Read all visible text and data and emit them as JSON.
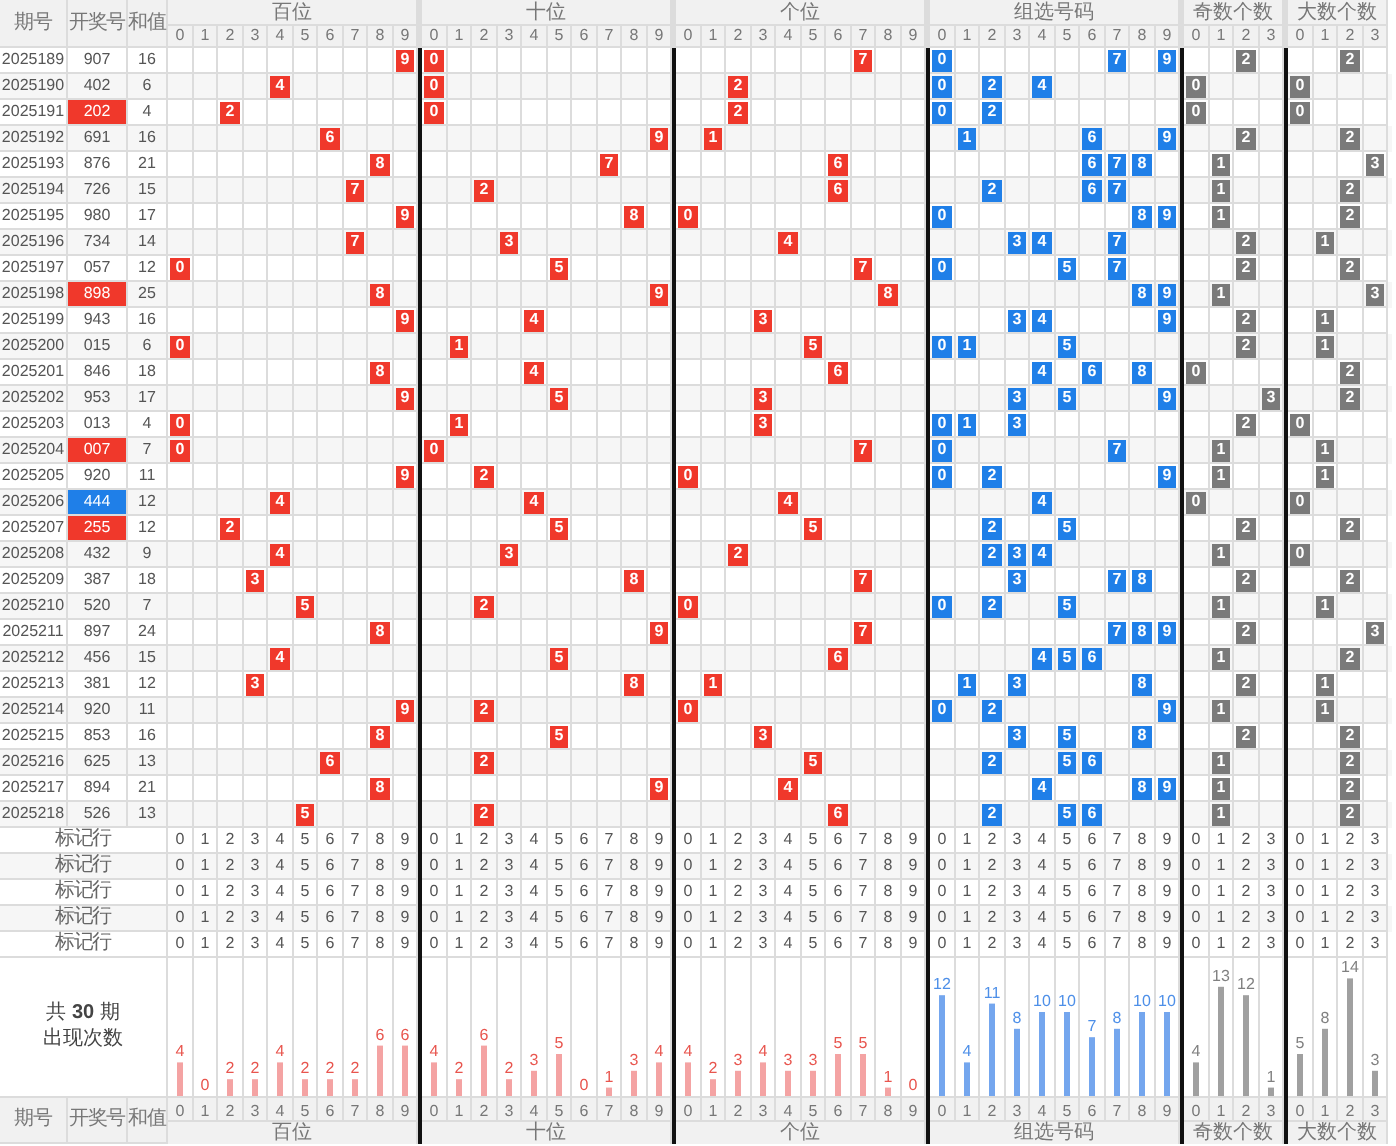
{
  "header": {
    "columns": [
      "期号",
      "开奖号",
      "和值"
    ]
  },
  "groups": [
    {
      "kind": "hundreds",
      "title": "百位",
      "digits": [
        "0",
        "1",
        "2",
        "3",
        "4",
        "5",
        "6",
        "7",
        "8",
        "9"
      ],
      "chart_data": {
        "type": "bar",
        "categories": [
          "0",
          "1",
          "2",
          "3",
          "4",
          "5",
          "6",
          "7",
          "8",
          "9"
        ],
        "series": [
          {
            "name": "百位",
            "color": "#f4a3a3",
            "values": [
              4,
              0,
              2,
              2,
              4,
              2,
              2,
              2,
              6,
              6
            ]
          }
        ],
        "data_labels": true
      }
    },
    {
      "kind": "tens",
      "title": "十位",
      "digits": [
        "0",
        "1",
        "2",
        "3",
        "4",
        "5",
        "6",
        "7",
        "8",
        "9"
      ],
      "chart_data": {
        "type": "bar",
        "categories": [
          "0",
          "1",
          "2",
          "3",
          "4",
          "5",
          "6",
          "7",
          "8",
          "9"
        ],
        "series": [
          {
            "name": "十位",
            "color": "#f4a3a3",
            "values": [
              4,
              2,
              6,
              2,
              3,
              5,
              0,
              1,
              3,
              4
            ]
          }
        ],
        "data_labels": true
      }
    },
    {
      "kind": "units",
      "title": "个位",
      "digits": [
        "0",
        "1",
        "2",
        "3",
        "4",
        "5",
        "6",
        "7",
        "8",
        "9"
      ],
      "chart_data": {
        "type": "bar",
        "categories": [
          "0",
          "1",
          "2",
          "3",
          "4",
          "5",
          "6",
          "7",
          "8",
          "9"
        ],
        "series": [
          {
            "name": "个位",
            "color": "#f4a3a3",
            "values": [
              4,
              2,
              3,
              4,
              3,
              3,
              5,
              5,
              1,
              0
            ]
          }
        ],
        "data_labels": true
      }
    },
    {
      "kind": "combo",
      "title": "组选号码",
      "digits": [
        "0",
        "1",
        "2",
        "3",
        "4",
        "5",
        "6",
        "7",
        "8",
        "9"
      ],
      "chart_data": {
        "type": "bar",
        "categories": [
          "0",
          "1",
          "2",
          "3",
          "4",
          "5",
          "6",
          "7",
          "8",
          "9"
        ],
        "series": [
          {
            "name": "组选号码",
            "color": "#74a6ee",
            "values": [
              12,
              4,
              11,
              8,
              10,
              10,
              7,
              8,
              10,
              10
            ]
          }
        ],
        "data_labels": true
      }
    },
    {
      "kind": "odd_count",
      "title": "奇数个数",
      "digits": [
        "0",
        "1",
        "2",
        "3"
      ],
      "chart_data": {
        "type": "bar",
        "categories": [
          "0",
          "1",
          "2",
          "3"
        ],
        "series": [
          {
            "name": "奇数个数",
            "color": "#a0a0a0",
            "values": [
              4,
              13,
              12,
              1
            ]
          }
        ],
        "data_labels": true
      }
    },
    {
      "kind": "big_count",
      "title": "大数个数",
      "digits": [
        "0",
        "1",
        "2",
        "3"
      ],
      "chart_data": {
        "type": "bar",
        "categories": [
          "0",
          "1",
          "2",
          "3"
        ],
        "series": [
          {
            "name": "大数个数",
            "color": "#a0a0a0",
            "values": [
              5,
              8,
              14,
              3
            ]
          }
        ],
        "data_labels": true
      }
    }
  ],
  "rows": [
    {
      "issue": "2025189",
      "number": "907",
      "sum": "16",
      "kind": "group6"
    },
    {
      "issue": "2025190",
      "number": "402",
      "sum": "6",
      "kind": "group6"
    },
    {
      "issue": "2025191",
      "number": "202",
      "sum": "4",
      "kind": "group3"
    },
    {
      "issue": "2025192",
      "number": "691",
      "sum": "16",
      "kind": "group6"
    },
    {
      "issue": "2025193",
      "number": "876",
      "sum": "21",
      "kind": "group6"
    },
    {
      "issue": "2025194",
      "number": "726",
      "sum": "15",
      "kind": "group6"
    },
    {
      "issue": "2025195",
      "number": "980",
      "sum": "17",
      "kind": "group6"
    },
    {
      "issue": "2025196",
      "number": "734",
      "sum": "14",
      "kind": "group6"
    },
    {
      "issue": "2025197",
      "number": "057",
      "sum": "12",
      "kind": "group6"
    },
    {
      "issue": "2025198",
      "number": "898",
      "sum": "25",
      "kind": "group3"
    },
    {
      "issue": "2025199",
      "number": "943",
      "sum": "16",
      "kind": "group6"
    },
    {
      "issue": "2025200",
      "number": "015",
      "sum": "6",
      "kind": "group6"
    },
    {
      "issue": "2025201",
      "number": "846",
      "sum": "18",
      "kind": "group6"
    },
    {
      "issue": "2025202",
      "number": "953",
      "sum": "17",
      "kind": "group6"
    },
    {
      "issue": "2025203",
      "number": "013",
      "sum": "4",
      "kind": "group6"
    },
    {
      "issue": "2025204",
      "number": "007",
      "sum": "7",
      "kind": "group3"
    },
    {
      "issue": "2025205",
      "number": "920",
      "sum": "11",
      "kind": "group6"
    },
    {
      "issue": "2025206",
      "number": "444",
      "sum": "12",
      "kind": "leopard"
    },
    {
      "issue": "2025207",
      "number": "255",
      "sum": "12",
      "kind": "group3"
    },
    {
      "issue": "2025208",
      "number": "432",
      "sum": "9",
      "kind": "group6"
    },
    {
      "issue": "2025209",
      "number": "387",
      "sum": "18",
      "kind": "group6"
    },
    {
      "issue": "2025210",
      "number": "520",
      "sum": "7",
      "kind": "group6"
    },
    {
      "issue": "2025211",
      "number": "897",
      "sum": "24",
      "kind": "group6"
    },
    {
      "issue": "2025212",
      "number": "456",
      "sum": "15",
      "kind": "group6"
    },
    {
      "issue": "2025213",
      "number": "381",
      "sum": "12",
      "kind": "group6"
    },
    {
      "issue": "2025214",
      "number": "920",
      "sum": "11",
      "kind": "group6"
    },
    {
      "issue": "2025215",
      "number": "853",
      "sum": "16",
      "kind": "group6"
    },
    {
      "issue": "2025216",
      "number": "625",
      "sum": "13",
      "kind": "group6"
    },
    {
      "issue": "2025217",
      "number": "894",
      "sum": "21",
      "kind": "group6"
    },
    {
      "issue": "2025218",
      "number": "526",
      "sum": "13",
      "kind": "group6"
    }
  ],
  "marker_rows": [
    {
      "label": "标记行",
      "cells": [
        [
          "0",
          "1",
          "2",
          "3",
          "4",
          "5",
          "6",
          "7",
          "8",
          "9"
        ],
        [
          "0",
          "1",
          "2",
          "3",
          "4",
          "5",
          "6",
          "7",
          "8",
          "9"
        ],
        [
          "0",
          "1",
          "2",
          "3",
          "4",
          "5",
          "6",
          "7",
          "8",
          "9"
        ],
        [
          "0",
          "1",
          "2",
          "3",
          "4",
          "5",
          "6",
          "7",
          "8",
          "9"
        ],
        [
          "0",
          "1",
          "2",
          "3"
        ],
        [
          "0",
          "1",
          "2",
          "3"
        ]
      ]
    },
    {
      "label": "标记行",
      "cells": [
        [
          "0",
          "1",
          "2",
          "3",
          "4",
          "5",
          "6",
          "7",
          "8",
          "9"
        ],
        [
          "0",
          "1",
          "2",
          "3",
          "4",
          "5",
          "6",
          "7",
          "8",
          "9"
        ],
        [
          "0",
          "1",
          "2",
          "3",
          "4",
          "5",
          "6",
          "7",
          "8",
          "9"
        ],
        [
          "0",
          "1",
          "2",
          "3",
          "4",
          "5",
          "6",
          "7",
          "8",
          "9"
        ],
        [
          "0",
          "1",
          "2",
          "3"
        ],
        [
          "0",
          "1",
          "2",
          "3"
        ]
      ]
    },
    {
      "label": "标记行",
      "cells": [
        [
          "0",
          "1",
          "2",
          "3",
          "4",
          "5",
          "6",
          "7",
          "8",
          "9"
        ],
        [
          "0",
          "1",
          "2",
          "3",
          "4",
          "5",
          "6",
          "7",
          "8",
          "9"
        ],
        [
          "0",
          "1",
          "2",
          "3",
          "4",
          "5",
          "6",
          "7",
          "8",
          "9"
        ],
        [
          "0",
          "1",
          "2",
          "3",
          "4",
          "5",
          "6",
          "7",
          "8",
          "9"
        ],
        [
          "0",
          "1",
          "2",
          "3"
        ],
        [
          "0",
          "1",
          "2",
          "3"
        ]
      ]
    },
    {
      "label": "标记行",
      "cells": [
        [
          "0",
          "1",
          "2",
          "3",
          "4",
          "5",
          "6",
          "7",
          "8",
          "9"
        ],
        [
          "0",
          "1",
          "2",
          "3",
          "4",
          "5",
          "6",
          "7",
          "8",
          "9"
        ],
        [
          "0",
          "1",
          "2",
          "3",
          "4",
          "5",
          "6",
          "7",
          "8",
          "9"
        ],
        [
          "0",
          "1",
          "2",
          "3",
          "4",
          "5",
          "6",
          "7",
          "8",
          "9"
        ],
        [
          "0",
          "1",
          "2",
          "3"
        ],
        [
          "0",
          "1",
          "2",
          "3"
        ]
      ]
    },
    {
      "label": "标记行",
      "cells": [
        [
          "0",
          "1",
          "2",
          "3",
          "4",
          "5",
          "6",
          "7",
          "8",
          "9"
        ],
        [
          "0",
          "1",
          "2",
          "3",
          "4",
          "5",
          "6",
          "7",
          "8",
          "9"
        ],
        [
          "0",
          "1",
          "2",
          "3",
          "4",
          "5",
          "6",
          "7",
          "8",
          "9"
        ],
        [
          "0",
          "1",
          "2",
          "3",
          "4",
          "5",
          "6",
          "7",
          "8",
          "9"
        ],
        [
          "0",
          "1",
          "2",
          "3"
        ],
        [
          "0",
          "1",
          "2",
          "3"
        ]
      ]
    }
  ],
  "summary": [
    "共 **30** 期",
    "出现次数"
  ],
  "footer": {
    "columns": [
      "期号",
      "开奖号",
      "和值"
    ]
  }
}
